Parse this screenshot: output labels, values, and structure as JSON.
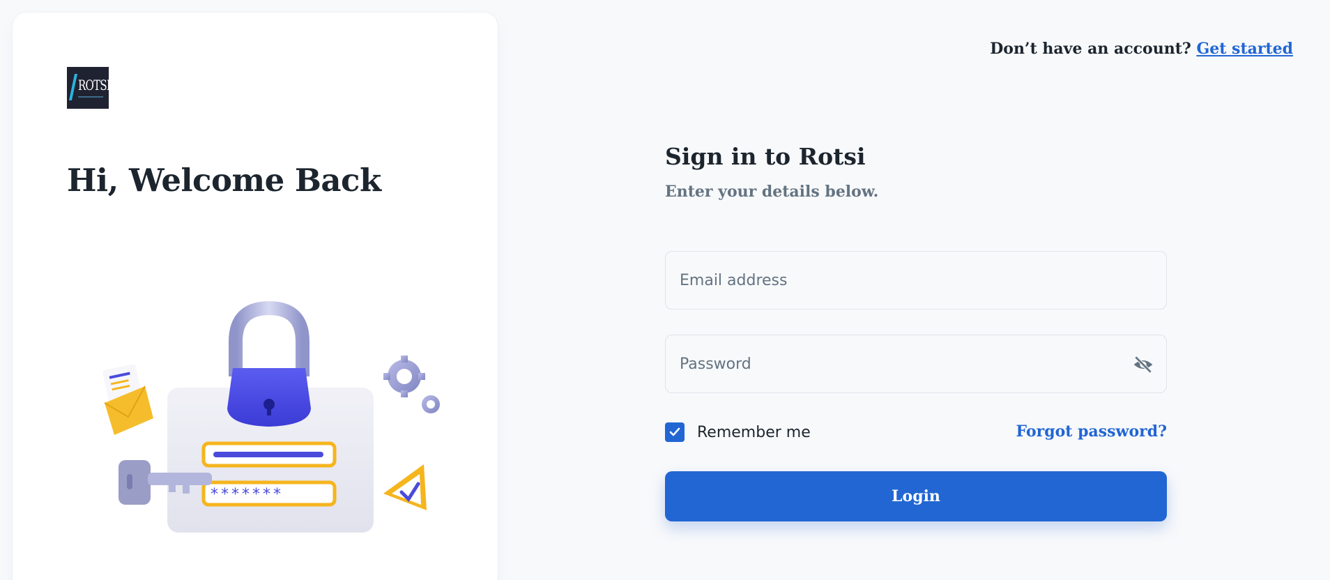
{
  "brand": {
    "logo_text": "ROTSI",
    "accent_color": "#2166d3"
  },
  "left": {
    "welcome_title": "Hi, Welcome Back",
    "illustration": "lock-login-illustration"
  },
  "header": {
    "prompt": "Don’t have an account?",
    "link_label": "Get started"
  },
  "form": {
    "title": "Sign in to Rotsi",
    "subtitle": "Enter your details below.",
    "email": {
      "placeholder": "Email address",
      "value": ""
    },
    "password": {
      "placeholder": "Password",
      "value": "",
      "toggle_icon": "eye-off-icon"
    },
    "remember": {
      "label": "Remember me",
      "checked": true
    },
    "forgot_label": "Forgot password?",
    "login_label": "Login"
  }
}
